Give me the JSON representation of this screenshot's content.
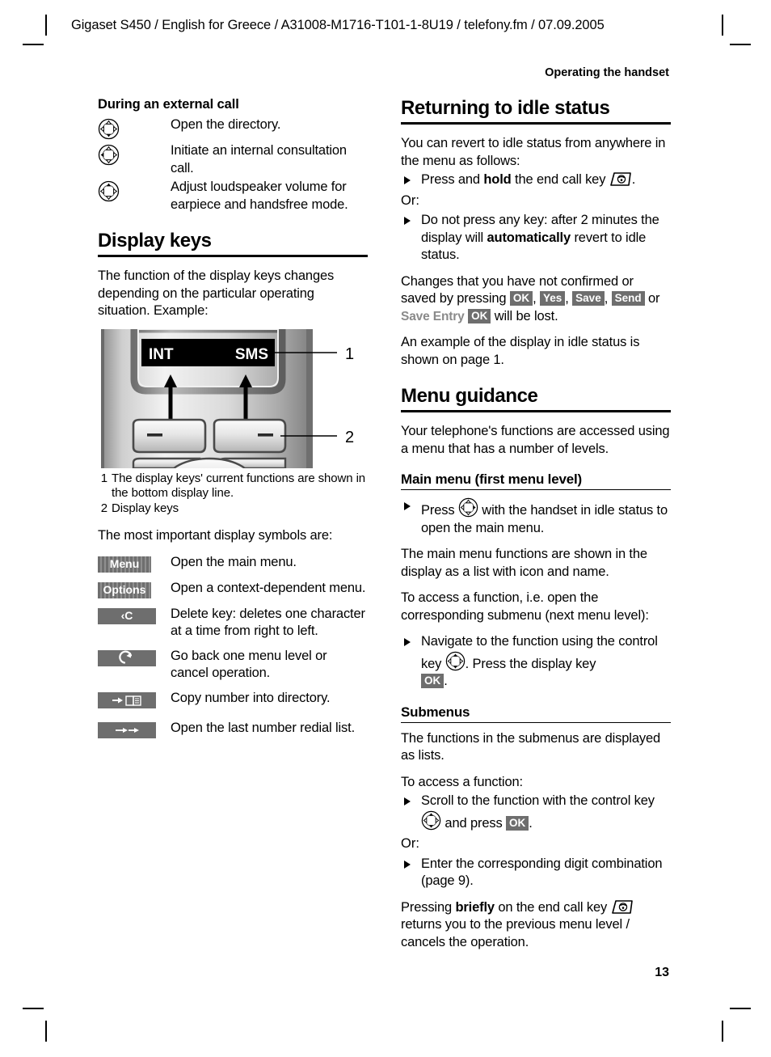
{
  "header": {
    "running_head": "Gigaset S450 / English for Greece / A31008-M1716-T101-1-8U19 / telefony.fm / 07.09.2005",
    "section_head": "Operating the handset"
  },
  "footer": {
    "page_number": "13"
  },
  "left_column": {
    "external_call": {
      "heading": "During an external call",
      "rows": [
        {
          "icon": "control-key-down-icon",
          "text": "Open the directory."
        },
        {
          "icon": "control-key-left-icon",
          "text": "Initiate an internal consultation call."
        },
        {
          "icon": "control-key-up-icon",
          "text": "Adjust loudspeaker volume for earpiece and handsfree mode."
        }
      ]
    },
    "display_keys": {
      "heading": "Display keys",
      "intro": "The function of the display keys changes depending on the particular operating situation. Example:",
      "figure": {
        "display_left_label": "INT",
        "display_right_label": "SMS",
        "callout_1": "1",
        "callout_2": "2"
      },
      "captions": [
        {
          "n": "1",
          "t": "The display keys' current functions are shown in the bottom display line."
        },
        {
          "n": "2",
          "t": "Display keys"
        }
      ],
      "symbols_intro": "The most important display symbols are:",
      "symbols": [
        {
          "label": "Menu",
          "style": "striped",
          "icon": "menu-softkey-icon",
          "text": "Open the main menu."
        },
        {
          "label": "Options",
          "style": "striped",
          "icon": "options-softkey-icon",
          "text": "Open a context-dependent menu."
        },
        {
          "label": "‹C",
          "style": "plain",
          "icon": "delete-softkey-icon",
          "text": "Delete key: deletes one character at a time from right to left."
        },
        {
          "label": "",
          "style": "glyph-back",
          "icon": "back-arrow-softkey-icon",
          "text": "Go back one menu level or cancel operation."
        },
        {
          "label": "",
          "style": "glyph-copy",
          "icon": "copy-to-directory-softkey-icon",
          "text": "Copy number into directory."
        },
        {
          "label": "",
          "style": "glyph-redial",
          "icon": "redial-softkey-icon",
          "text": "Open the last number redial list."
        }
      ]
    }
  },
  "right_column": {
    "returning": {
      "heading": "Returning to idle status",
      "p1": "You can revert to idle status from anywhere in the menu as follows:",
      "b1_pre": "Press and ",
      "b1_bold": "hold",
      "b1_post": " the end call key ",
      "b1_end": ".",
      "or1": "Or:",
      "b2_pre": "Do not press any key: after 2 minutes the display will ",
      "b2_bold": "automatically",
      "b2_post": " revert to idle status.",
      "p2_pre": "Changes that you have not confirmed or saved by pressing ",
      "badge_ok": "OK",
      "badge_yes": "Yes",
      "badge_save": "Save",
      "badge_send": "Send",
      "p2_or": " or ",
      "save_entry_label": "Save Entry",
      "badge_ok2": "OK",
      "p2_post": " will be lost.",
      "p3": "An example of the display in idle status is shown on page 1."
    },
    "menu_guidance": {
      "heading": "Menu guidance",
      "p1": "Your telephone's functions are accessed using a menu that has a number of levels.",
      "main_menu": {
        "heading": "Main menu (first menu level)",
        "b1_pre": "Press ",
        "b1_post": " with the handset in idle status to open the main menu.",
        "p1": "The main menu functions are shown in the display as a list with icon and name.",
        "p2": "To access a function, i.e. open the corresponding submenu (next menu level):",
        "b2_pre": "Navigate to the function using the control key ",
        "b2_mid": ". Press the display key ",
        "badge_ok": "OK",
        "b2_post": "."
      },
      "submenus": {
        "heading": "Submenus",
        "p1": "The functions in the submenus are displayed as lists.",
        "p2": "To access a function:",
        "b1_pre": "Scroll to the function with the control key ",
        "b1_mid": " and press ",
        "badge_ok": "OK",
        "b1_post": ".",
        "or": "Or:",
        "b2": "Enter the corresponding digit combination (page 9).",
        "p3_pre": "Pressing ",
        "p3_bold": "briefly",
        "p3_mid": " on the end call key ",
        "p3_post": " returns you to the previous menu level / cancels the operation."
      }
    }
  },
  "colors": {
    "badge_grey": "#6e6e6e",
    "save_entry_grey": "#8a8a8a",
    "display_black": "#000000"
  }
}
